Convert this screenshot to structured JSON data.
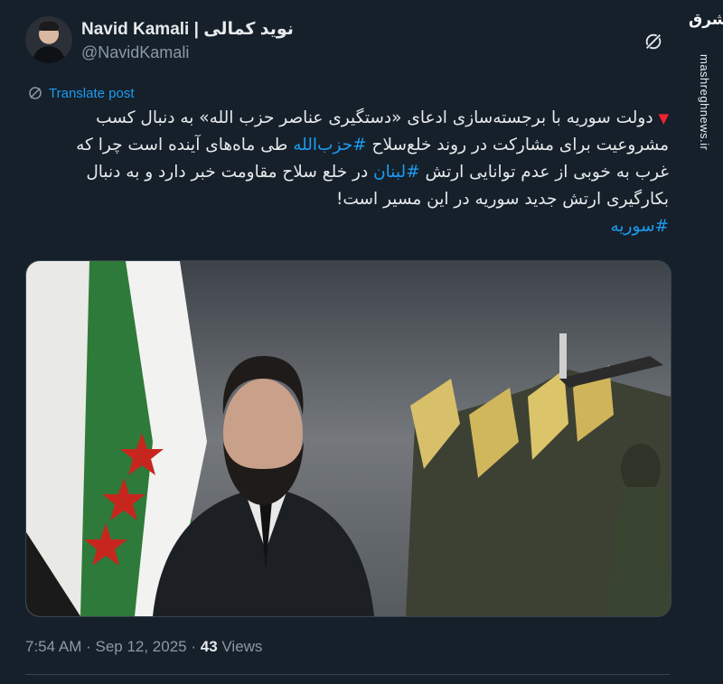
{
  "author": {
    "display_name": "Navid Kamali | نوید کمالی",
    "handle": "@NavidKamali"
  },
  "translate_label": "Translate post",
  "tweet": {
    "marker": "▼",
    "line1": "دولت سوریه با برجسته‌سازی ادعای «دستگیری عناصر حزب الله» به دنبال کسب",
    "line2_a": "مشروعیت برای مشارکت در روند خلع‌سلاح ",
    "line2_tag": "#حزب‌الله",
    "line2_b": " طی ماه‌های آینده است چرا که",
    "line3_a": "غرب به خوبی از عدم توانایی ارتش ",
    "line3_tag": "#لبنان",
    "line3_b": " در خلع سلاح مقاومت خبر دارد و به دنبال",
    "line4": "بکارگیری ارتش جدید سوریه در این مسیر است!",
    "line5_tag": "#سوریه"
  },
  "meta": {
    "time": "7:54 AM",
    "sep": " · ",
    "date": "Sep 12, 2025",
    "sep2": " · ",
    "views_count": "43",
    "views_label": " Views"
  },
  "watermark": {
    "logo": "مشرق",
    "url": "mashreghnews.ir"
  },
  "colors": {
    "background": "#15202b",
    "link": "#1d9bf0",
    "muted": "#8b98a5"
  }
}
